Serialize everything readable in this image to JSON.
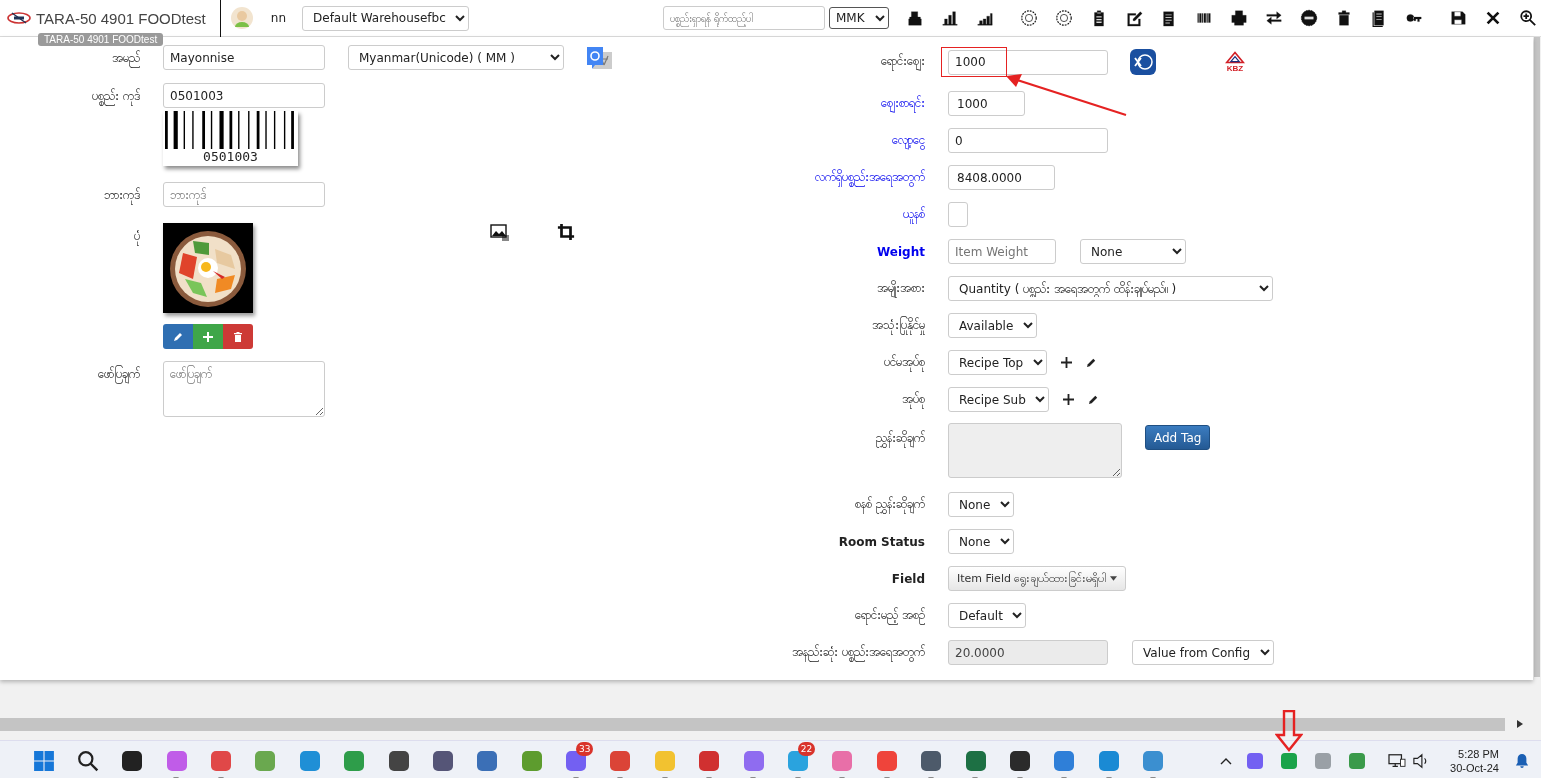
{
  "header": {
    "app_title": "TARA-50 4901 FOODtest",
    "tooltip": "TARA-50 4901 FOODtest",
    "user": "nn",
    "warehouse": "Default Warehousefbc",
    "search_placeholder": "ပစ္စည်းရှာရန် ရိုက်ထည့်ပါ",
    "currency": "MMK"
  },
  "left_form": [
    {
      "kind": "name",
      "label": "အမည်",
      "value": "Mayonnise",
      "language": "Myanmar(Unicode) ( MM )"
    },
    {
      "kind": "code",
      "label": "ပစ္စည်း ကုဒ်",
      "value": "0501003",
      "barcode_text": "0501003"
    },
    {
      "kind": "text",
      "label": "ဘားကုဒ်",
      "placeholder": "ဘားကုဒ်"
    },
    {
      "label": "ပုံ"
    },
    {
      "kind": "textarea",
      "label": "ဖော်ပြချက်",
      "placeholder": "ဖော်ပြချက်"
    }
  ],
  "right_form": [
    {
      "kind": "price",
      "label": "ရောင်းဈေး",
      "blue": false,
      "bold": false,
      "value": "1000",
      "highlighted": true,
      "bank_logo": "KBZ"
    },
    {
      "kind": "compact-input",
      "label": "ဈေးစာရင်း",
      "blue": true,
      "bold": false,
      "value": "1000"
    },
    {
      "kind": "input",
      "label": "လျော့ငွေ",
      "blue": true,
      "bold": false,
      "value": "0"
    },
    {
      "kind": "compact-input",
      "label": "လက်ရှိပစ္စည်းအရေအတွက်",
      "blue": true,
      "bold": false,
      "value": "8408.0000"
    },
    {
      "kind": "checkbox",
      "label": "ယူနစ်",
      "blue": true,
      "bold": false,
      "checked": false
    },
    {
      "kind": "weight",
      "label": "Weight",
      "blue": true,
      "bold": true,
      "placeholder": "Item Weight",
      "unit": "None"
    },
    {
      "kind": "wide-select",
      "label": "အမျိုးအစား",
      "blue": false,
      "bold": false,
      "value": "Quantity ( ပစ္စည်း အရေအတွက် ထိန်းချုပ်မည်။ )"
    },
    {
      "kind": "select",
      "label": "အသုံးပြုနိုင်မှု",
      "blue": false,
      "bold": false,
      "value": "Available"
    },
    {
      "kind": "select-actions",
      "label": "ပင်မအုပ်စု",
      "blue": false,
      "bold": false,
      "value": "Recipe Top"
    },
    {
      "kind": "select-actions",
      "label": "အုပ်စု",
      "blue": false,
      "bold": false,
      "value": "Recipe Sub"
    },
    {
      "kind": "tags",
      "label": "ညွှန်းဆိုချက်",
      "blue": false,
      "bold": false,
      "button": "Add Tag"
    },
    {
      "kind": "select",
      "label": "စနစ် ညွှန်းဆိုချက်",
      "blue": false,
      "bold": false,
      "value": "None"
    },
    {
      "kind": "select",
      "label": "Room Status",
      "blue": false,
      "bold": true,
      "value": "None"
    },
    {
      "kind": "dropdown",
      "label": "Field",
      "blue": false,
      "bold": true,
      "value": "Item Field ရွေးချယ်ထားခြင်းမရှိပါ"
    },
    {
      "kind": "select",
      "label": "ရောင်းမည့် အစဉ်",
      "blue": false,
      "bold": false,
      "value": "Default"
    },
    {
      "kind": "disabled-input",
      "label": "အနည်းဆုံး ပစ္စည်းအရေအတွက်",
      "blue": false,
      "bold": false,
      "value": "20.0000",
      "option": "Value from Config"
    }
  ],
  "taskbar": {
    "apps": [
      {
        "color": "#222222",
        "running": false
      },
      {
        "color": "#c05ce8",
        "running": true
      },
      {
        "color": "#e04848",
        "running": true
      },
      {
        "color": "#6aa84f",
        "running": false
      },
      {
        "color": "#1f8fd6",
        "running": false
      },
      {
        "color": "#2e9d4a",
        "running": false
      },
      {
        "color": "#444444",
        "running": false
      },
      {
        "color": "#555577",
        "running": false
      },
      {
        "color": "#3b6fb6",
        "running": false
      },
      {
        "color": "#5d9c2e",
        "running": false
      },
      {
        "color": "#7360f2",
        "running": true,
        "badge": "33"
      },
      {
        "color": "#db4437",
        "running": true
      },
      {
        "color": "#f2c230",
        "running": true
      },
      {
        "color": "#d03030",
        "running": true
      },
      {
        "color": "#8f6cf0",
        "running": true
      },
      {
        "color": "#2aa3de",
        "running": true,
        "badge": "22"
      },
      {
        "color": "#e86fa8",
        "running": true
      },
      {
        "color": "#ef443b",
        "running": true
      },
      {
        "color": "#4d5a6a",
        "running": true
      },
      {
        "color": "#1d7044",
        "running": true
      },
      {
        "color": "#2b2b2b",
        "running": true
      },
      {
        "color": "#2f7fd8",
        "running": true
      },
      {
        "color": "#1a8ad4",
        "running": true
      },
      {
        "color": "#3b8fd0",
        "running": true
      }
    ],
    "tray": [
      {
        "color": "#7360f2",
        "marked": false
      },
      {
        "color": "#1aa34a",
        "marked": true
      },
      {
        "color": "#9aa0a6",
        "marked": false
      },
      {
        "color": "#3a9a4a",
        "marked": false
      }
    ],
    "time": "5:28 PM",
    "date": "30-Oct-24"
  }
}
